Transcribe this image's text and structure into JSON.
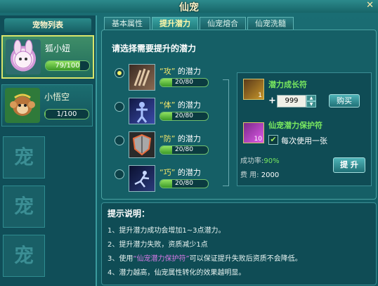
{
  "window": {
    "title": "仙宠"
  },
  "sidebar": {
    "header": "宠物列表",
    "pets": [
      {
        "name": "狐小妞",
        "exp": "79/100",
        "ratio": 0.79
      },
      {
        "name": "小悟空",
        "exp": "1/100",
        "ratio": 0.01
      }
    ],
    "empty_slot": "宠"
  },
  "tabs": [
    {
      "label": "基本属性"
    },
    {
      "label": "提升潜力",
      "active": true
    },
    {
      "label": "仙宠熔合"
    },
    {
      "label": "仙宠洗髓"
    }
  ],
  "main": {
    "prompt": "请选择需要提升的潜力",
    "potentials": [
      {
        "quote_open": "“",
        "name": "攻",
        "quote_close": "”",
        "suffix": "的潜力",
        "value": "20/80",
        "ratio": 0.25,
        "selected": true,
        "icon": "claw-icon"
      },
      {
        "quote_open": "“",
        "name": "体",
        "quote_close": "”",
        "suffix": "的潜力",
        "value": "20/80",
        "ratio": 0.25,
        "selected": false,
        "icon": "body-icon"
      },
      {
        "quote_open": "“",
        "name": "防",
        "quote_close": "”",
        "suffix": "的潜力",
        "value": "20/80",
        "ratio": 0.25,
        "selected": false,
        "icon": "shield-icon"
      },
      {
        "quote_open": "“",
        "name": "巧",
        "quote_close": "”",
        "suffix": "的潜力",
        "value": "20/80",
        "ratio": 0.25,
        "selected": false,
        "icon": "agility-icon"
      }
    ],
    "growth": {
      "title": "潜力成长符",
      "count": "1",
      "plus": "+",
      "quantity": "999",
      "buy_label": "购买"
    },
    "protect": {
      "title": "仙宠潜力保护符",
      "count": "10",
      "check_label": "每次使用一张",
      "checked": true
    },
    "rate": {
      "label1": "成功率:",
      "value1": "90%",
      "label2": "费  用:",
      "value2": "2000"
    },
    "upgrade_label": "提 升"
  },
  "hints": {
    "title": "提示说明：",
    "lines": [
      {
        "a": "1、提升潜力成功会增加1~3点潜力。"
      },
      {
        "a": "2、提升潜力失败，资质减少1点"
      },
      {
        "a": "3、使用",
        "hi": "“仙宠潜力保护符”",
        "b": "可以保证提升失败后资质不会降低。"
      },
      {
        "a": "4、潜力越高，仙宠属性转化的效果越明显。"
      }
    ]
  },
  "colors": {
    "accent": "#f3e76a",
    "progress": "#79e85f",
    "panel": "#155f66"
  }
}
